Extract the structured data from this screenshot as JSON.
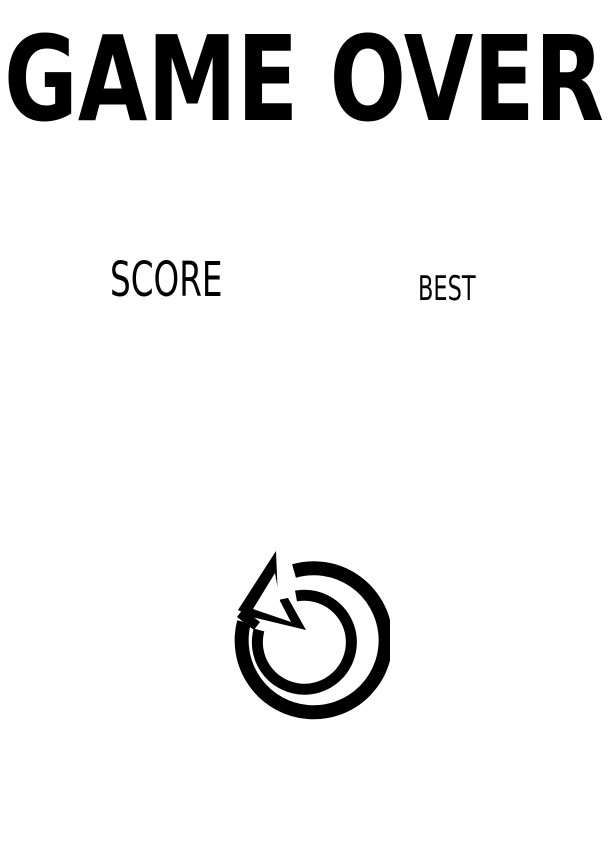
{
  "game_over": {
    "title": "GAME OVER",
    "score_label": "SCORE",
    "best_label": "BEST"
  },
  "controls": {
    "replay_icon": "replay-icon"
  },
  "colors": {
    "background": "#ffffff",
    "foreground": "#000000"
  }
}
